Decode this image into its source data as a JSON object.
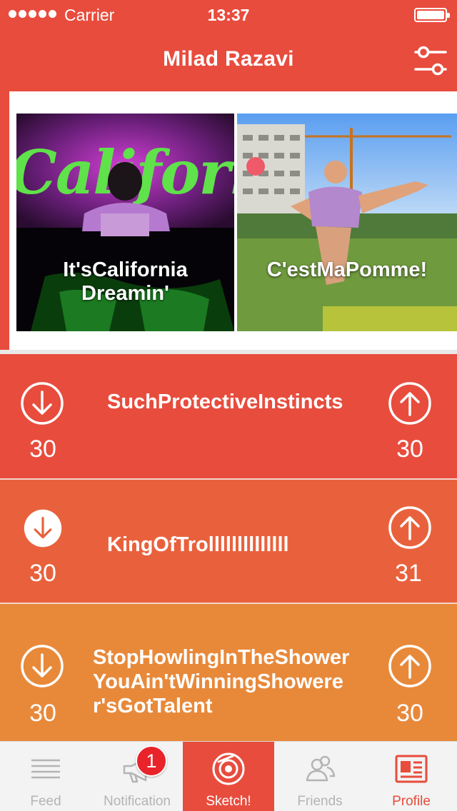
{
  "status_bar": {
    "carrier": "Carrier",
    "time": "13:37"
  },
  "header": {
    "title": "Milad Razavi",
    "settings_icon": "sliders-icon"
  },
  "featured": [
    {
      "label": "It'sCalifornia Dreamin'"
    },
    {
      "label": "C'estMaPomme!"
    }
  ],
  "posts": [
    {
      "title": "SuchProtectiveInstincts",
      "downvotes": "30",
      "upvotes": "30",
      "down_filled": false
    },
    {
      "title": "KingOfTrollllllllllllll",
      "downvotes": "30",
      "upvotes": "31",
      "down_filled": true
    },
    {
      "title": "StopHowlingInTheShowerYouAin'tWinningShowerer'sGotTalent",
      "downvotes": "30",
      "upvotes": "30",
      "down_filled": false
    }
  ],
  "tabs": [
    {
      "label": "Feed",
      "icon": "list-icon"
    },
    {
      "label": "Notification",
      "icon": "megaphone-icon",
      "badge": "1"
    },
    {
      "label": "Sketch!",
      "icon": "camera-icon"
    },
    {
      "label": "Friends",
      "icon": "people-icon"
    },
    {
      "label": "Profile",
      "icon": "newspaper-icon"
    }
  ],
  "colors": {
    "brand_red": "#e84c3d",
    "row_orange_red": "#e9613c",
    "row_orange": "#e8893a",
    "badge_red": "#e8232a"
  }
}
